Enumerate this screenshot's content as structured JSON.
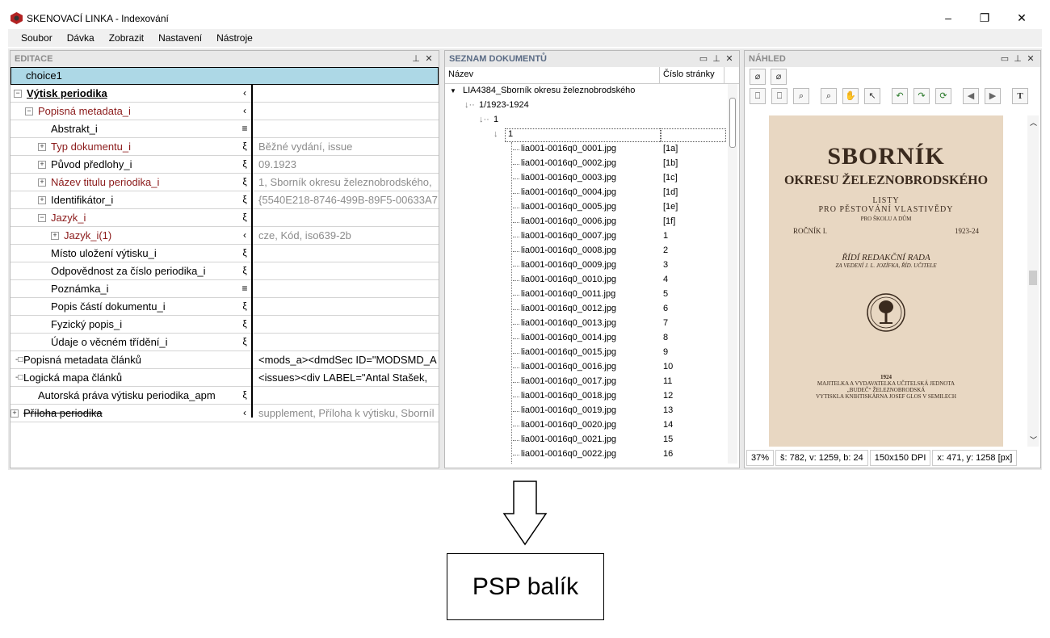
{
  "window": {
    "title": "SKENOVACÍ LINKA - Indexování",
    "minimize": "–",
    "maximize": "❐",
    "close": "✕"
  },
  "menu": [
    "Soubor",
    "Dávka",
    "Zobrazit",
    "Nastavení",
    "Nástroje"
  ],
  "editor": {
    "title": "EDITACE",
    "pin": "📌",
    "close": "✕",
    "selected": "choice1",
    "rows": [
      {
        "label": "Výtisk periodika",
        "sym": "‹",
        "value": "",
        "exp": "−"
      },
      {
        "label": "Popisná metadata_i",
        "sym": "‹",
        "value": "",
        "exp": "−"
      },
      {
        "label": "Abstrakt_i",
        "sym": "≡",
        "value": "",
        "exp": ""
      },
      {
        "label": "Typ dokumentu_i",
        "sym": "ξ",
        "value": "Běžné vydání, issue",
        "exp": "+"
      },
      {
        "label": "Původ předlohy_i",
        "sym": "ξ",
        "value": "09.1923",
        "exp": "+"
      },
      {
        "label": "Název titulu periodika_i",
        "sym": "ξ",
        "value": "1, Sborník okresu železnobrodského,",
        "exp": "+"
      },
      {
        "label": "Identifikátor_i",
        "sym": "ξ",
        "value": "{5540E218-8746-499B-89F5-00633A7F",
        "exp": "+"
      },
      {
        "label": "Jazyk_i",
        "sym": "ξ",
        "value": "",
        "exp": "−"
      },
      {
        "label": "Jazyk_i(1)",
        "sym": "‹",
        "value": "cze, Kód, iso639-2b",
        "exp": "+"
      },
      {
        "label": "Místo uložení výtisku_i",
        "sym": "ξ",
        "value": "",
        "exp": ""
      },
      {
        "label": "Odpovědnost za číslo periodika_i",
        "sym": "ξ",
        "value": "",
        "exp": ""
      },
      {
        "label": "Poznámka_i",
        "sym": "≡",
        "value": "",
        "exp": ""
      },
      {
        "label": "Popis částí dokumentu_i",
        "sym": "ξ",
        "value": "",
        "exp": ""
      },
      {
        "label": "Fyzický popis_i",
        "sym": "ξ",
        "value": "",
        "exp": ""
      },
      {
        "label": "Údaje o věcném třídění_i",
        "sym": "ξ",
        "value": "",
        "exp": ""
      },
      {
        "label": "Popisná metadata článků",
        "sym": "",
        "value": "<mods_a><dmdSec ID=\"MODSMD_A",
        "exp": "-□"
      },
      {
        "label": "Logická mapa článků",
        "sym": "",
        "value": "<issues><div LABEL=\"Antal Stašek,",
        "exp": "-□"
      },
      {
        "label": "Autorská práva výtisku periodika_apm",
        "sym": "ξ",
        "value": "",
        "exp": ""
      },
      {
        "label": "Příloha periodika",
        "sym": "‹",
        "value": "supplement, Příloha k výtisku, Sborníl",
        "exp": "+"
      }
    ]
  },
  "doclist": {
    "title": "SEZNAM DOKUMENTŮ",
    "col_name": "Název",
    "col_page": "Číslo stránky",
    "root": "LIA4384_Sborník okresu železnobrodského",
    "volume": "1/1923-1924",
    "issue": "1",
    "sub": "1",
    "files": [
      {
        "name": "lia001-0016q0_0001.jpg",
        "page": "[1a]"
      },
      {
        "name": "lia001-0016q0_0002.jpg",
        "page": "[1b]"
      },
      {
        "name": "lia001-0016q0_0003.jpg",
        "page": "[1c]"
      },
      {
        "name": "lia001-0016q0_0004.jpg",
        "page": "[1d]"
      },
      {
        "name": "lia001-0016q0_0005.jpg",
        "page": "[1e]"
      },
      {
        "name": "lia001-0016q0_0006.jpg",
        "page": "[1f]"
      },
      {
        "name": "lia001-0016q0_0007.jpg",
        "page": "1"
      },
      {
        "name": "lia001-0016q0_0008.jpg",
        "page": "2"
      },
      {
        "name": "lia001-0016q0_0009.jpg",
        "page": "3"
      },
      {
        "name": "lia001-0016q0_0010.jpg",
        "page": "4"
      },
      {
        "name": "lia001-0016q0_0011.jpg",
        "page": "5"
      },
      {
        "name": "lia001-0016q0_0012.jpg",
        "page": "6"
      },
      {
        "name": "lia001-0016q0_0013.jpg",
        "page": "7"
      },
      {
        "name": "lia001-0016q0_0014.jpg",
        "page": "8"
      },
      {
        "name": "lia001-0016q0_0015.jpg",
        "page": "9"
      },
      {
        "name": "lia001-0016q0_0016.jpg",
        "page": "10"
      },
      {
        "name": "lia001-0016q0_0017.jpg",
        "page": "11"
      },
      {
        "name": "lia001-0016q0_0018.jpg",
        "page": "12"
      },
      {
        "name": "lia001-0016q0_0019.jpg",
        "page": "13"
      },
      {
        "name": "lia001-0016q0_0020.jpg",
        "page": "14"
      },
      {
        "name": "lia001-0016q0_0021.jpg",
        "page": "15"
      },
      {
        "name": "lia001-0016q0_0022.jpg",
        "page": "16"
      }
    ]
  },
  "preview": {
    "title": "NÁHLED",
    "page": {
      "l1": "SBORNÍK",
      "l2": "OKRESU ŽELEZNOBRODSKÉHO",
      "l3": "LISTY",
      "l4": "PRO PĚSTOVÁNÍ VLASTIVĚDY",
      "l5": "PRO ŠKOLU A DŮM",
      "l6a": "ROČNÍK I.",
      "l6b": "1923-24",
      "l7": "ŘÍDÍ REDAKČNÍ RADA",
      "l8": "ZA VEDENÍ J. L. JOZÍFKA, ŘÍD. UČITELE",
      "l9": "1924",
      "l10": "MAJITELKA A VYDAVATELKA UČITELSKÁ JEDNOTA",
      "l11": "„BUDEČ“ ŽELEZNOBRODSKÁ",
      "l12": "VYTISKLA KNIHTISKÁRNA JOSEF GLOS V SEMILECH"
    },
    "status": [
      "37%",
      "š: 782, v: 1259, b: 24",
      "150x150 DPI",
      "x: 471, y: 1258 [px]"
    ]
  },
  "output_box": "PSP balík"
}
